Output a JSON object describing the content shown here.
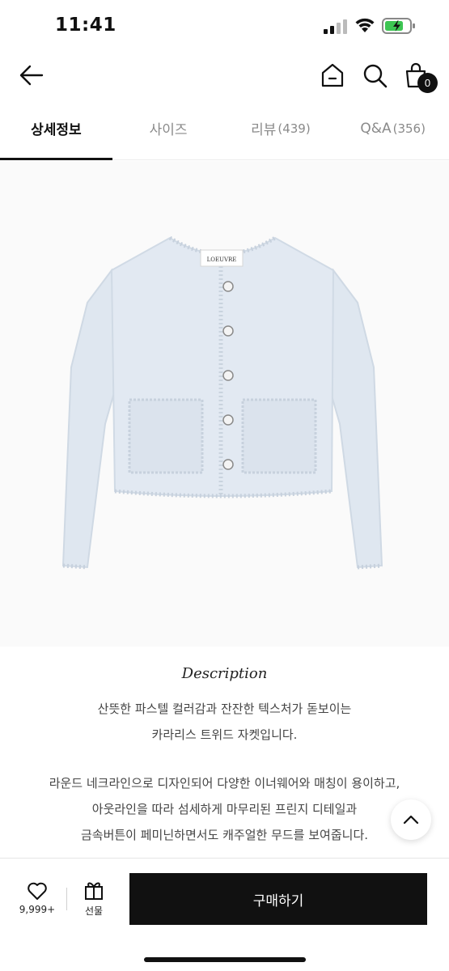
{
  "status": {
    "time": "11:41"
  },
  "header": {
    "cart_count": "0"
  },
  "tabs": [
    {
      "label": "상세정보",
      "count": ""
    },
    {
      "label": "사이즈",
      "count": ""
    },
    {
      "label": "리뷰",
      "count": "(439)"
    },
    {
      "label": "Q&A",
      "count": "(356)"
    }
  ],
  "product": {
    "brand_tag": "LOEUVRE"
  },
  "description": {
    "title": "Description",
    "para1_line1": "산뜻한 파스텔 컬러감과 잔잔한 텍스처가 돋보이는",
    "para1_line2": "카라리스 트위드 자켓입니다.",
    "para2_line1": "라운드 네크라인으로 디자인되어 다양한 이너웨어와 매칭이 용이하고,",
    "para2_line2": "아웃라인을 따라 섬세하게 마무리된 프린지 디테일과",
    "para2_line3": "금속버튼이 페미닌하면서도 캐주얼한 무드를 보여줍니다."
  },
  "bottom_bar": {
    "like_count": "9,999+",
    "gift_label": "선물",
    "buy_label": "구매하기"
  },
  "colors": {
    "primary": "#111111",
    "jacket": "#dde6ef",
    "muted_text": "#8a8a8a"
  }
}
